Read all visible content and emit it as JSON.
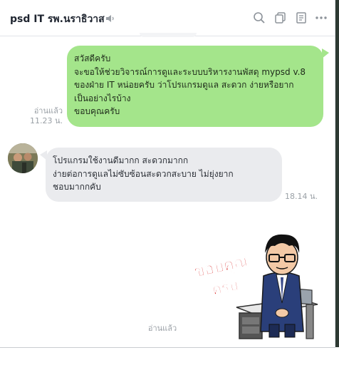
{
  "chat": {
    "title": "psd IT รพ.นราธิวาส",
    "header_icons": [
      "speaker-mute-icon",
      "search-icon",
      "copy-icon",
      "notes-icon",
      "more-icon"
    ]
  },
  "messages": {
    "outgoing_1": {
      "lines": [
        "สวัสดีครับ",
        "จะขอให้ช่วยวิจารณ์การดูและระบบบริหารงานพัสดุ mypsd v.8",
        "ของฝ่าย IT หน่อยครับ ว่าโปรแกรมดูแล สะดวก ง่ายหรือยาก",
        "เป็นอย่างไรบ้าง",
        "ขอบคุณครับ"
      ],
      "read_label": "อ่านแล้ว",
      "time": "11.23 น."
    },
    "incoming_1": {
      "lines": [
        "โปรแกรมใช้งานดีมากก สะดวกมากก",
        "ง่ายต่อการดูแลไม่ซับซ้อนสะดวกสะบาย ไม่ยุ่งยาก",
        "ชอบมากกคับ"
      ],
      "time": "18.14 น."
    },
    "sticker": {
      "text_line1": "ขอบคุณ",
      "text_line2": "ครับ"
    },
    "bottom_read_label": "อ่านแล้ว"
  },
  "colors": {
    "outgoing_bubble": "#a4e58b",
    "incoming_bubble": "#eaebee",
    "sticker_text": "#d62222"
  }
}
